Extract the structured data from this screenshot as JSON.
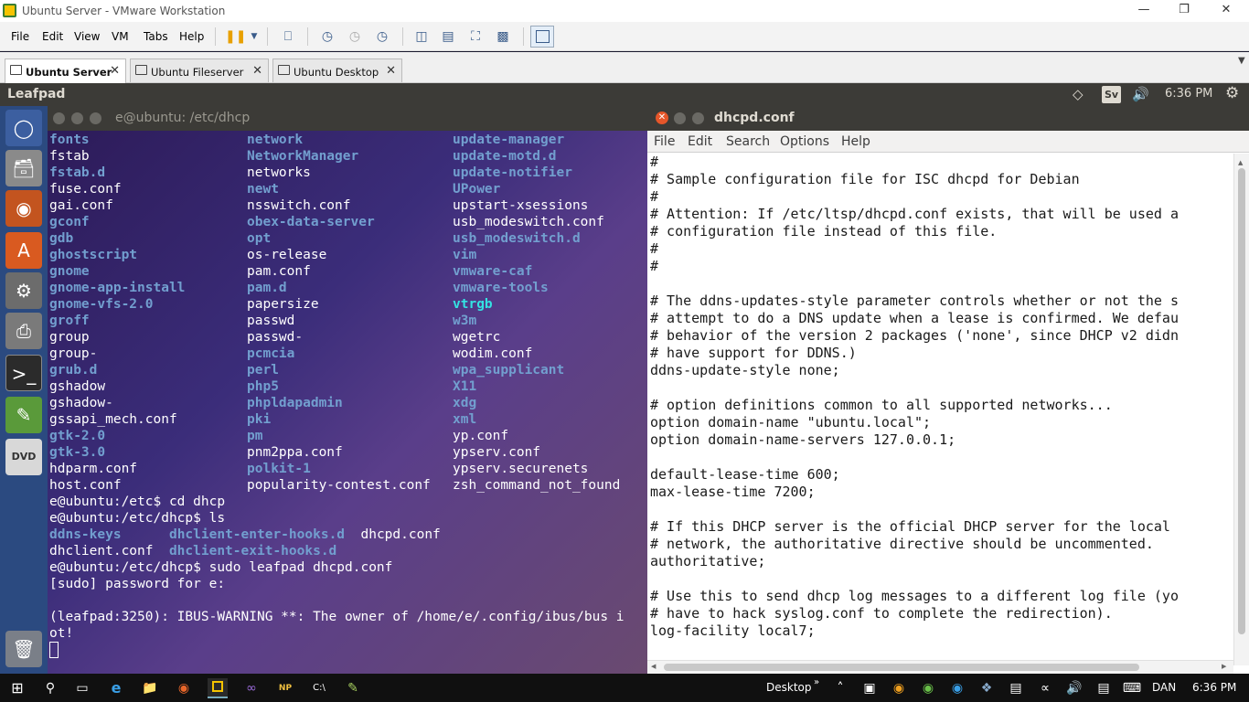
{
  "vm": {
    "title": "Ubuntu Server - VMware Workstation",
    "menus": [
      "File",
      "Edit",
      "View",
      "VM",
      "Tabs",
      "Help"
    ],
    "tabs": [
      {
        "label": "Ubuntu Server",
        "active": true
      },
      {
        "label": "Ubuntu Fileserver",
        "active": false
      },
      {
        "label": "Ubuntu Desktop",
        "active": false
      }
    ]
  },
  "ubuntu_panel": {
    "app_name": "Leafpad",
    "keyboard": "Sv",
    "clock": "6:36 PM"
  },
  "terminal": {
    "title": "e@ubuntu: /etc/dhcp",
    "listing": {
      "col1": [
        {
          "t": "fonts",
          "s": "b"
        },
        {
          "t": "fstab",
          "s": ""
        },
        {
          "t": "fstab.d",
          "s": "b"
        },
        {
          "t": "fuse.conf",
          "s": ""
        },
        {
          "t": "gai.conf",
          "s": ""
        },
        {
          "t": "gconf",
          "s": "b"
        },
        {
          "t": "gdb",
          "s": "b"
        },
        {
          "t": "ghostscript",
          "s": "b"
        },
        {
          "t": "gnome",
          "s": "b"
        },
        {
          "t": "gnome-app-install",
          "s": "b"
        },
        {
          "t": "gnome-vfs-2.0",
          "s": "b"
        },
        {
          "t": "groff",
          "s": "b"
        },
        {
          "t": "group",
          "s": ""
        },
        {
          "t": "group-",
          "s": ""
        },
        {
          "t": "grub.d",
          "s": "b"
        },
        {
          "t": "gshadow",
          "s": ""
        },
        {
          "t": "gshadow-",
          "s": ""
        },
        {
          "t": "gssapi_mech.conf",
          "s": ""
        },
        {
          "t": "gtk-2.0",
          "s": "b"
        },
        {
          "t": "gtk-3.0",
          "s": "b"
        },
        {
          "t": "hdparm.conf",
          "s": ""
        },
        {
          "t": "host.conf",
          "s": ""
        }
      ],
      "col2": [
        {
          "t": "network",
          "s": "b"
        },
        {
          "t": "NetworkManager",
          "s": "b"
        },
        {
          "t": "networks",
          "s": ""
        },
        {
          "t": "newt",
          "s": "b"
        },
        {
          "t": "nsswitch.conf",
          "s": ""
        },
        {
          "t": "obex-data-server",
          "s": "b"
        },
        {
          "t": "opt",
          "s": "b"
        },
        {
          "t": "os-release",
          "s": ""
        },
        {
          "t": "pam.conf",
          "s": ""
        },
        {
          "t": "pam.d",
          "s": "b"
        },
        {
          "t": "papersize",
          "s": ""
        },
        {
          "t": "passwd",
          "s": ""
        },
        {
          "t": "passwd-",
          "s": ""
        },
        {
          "t": "pcmcia",
          "s": "b"
        },
        {
          "t": "perl",
          "s": "b"
        },
        {
          "t": "php5",
          "s": "b"
        },
        {
          "t": "phpldapadmin",
          "s": "b"
        },
        {
          "t": "pki",
          "s": "b"
        },
        {
          "t": "pm",
          "s": "b"
        },
        {
          "t": "pnm2ppa.conf",
          "s": ""
        },
        {
          "t": "polkit-1",
          "s": "b"
        },
        {
          "t": "popularity-contest.conf",
          "s": ""
        }
      ],
      "col3": [
        {
          "t": "update-manager",
          "s": "b"
        },
        {
          "t": "update-motd.d",
          "s": "b"
        },
        {
          "t": "update-notifier",
          "s": "b"
        },
        {
          "t": "UPower",
          "s": "b"
        },
        {
          "t": "upstart-xsessions",
          "s": ""
        },
        {
          "t": "usb_modeswitch.conf",
          "s": ""
        },
        {
          "t": "usb_modeswitch.d",
          "s": "b"
        },
        {
          "t": "vim",
          "s": "b"
        },
        {
          "t": "vmware-caf",
          "s": "b"
        },
        {
          "t": "vmware-tools",
          "s": "b"
        },
        {
          "t": "vtrgb",
          "s": "bc"
        },
        {
          "t": "w3m",
          "s": "b"
        },
        {
          "t": "wgetrc",
          "s": ""
        },
        {
          "t": "wodim.conf",
          "s": ""
        },
        {
          "t": "wpa_supplicant",
          "s": "b"
        },
        {
          "t": "X11",
          "s": "b"
        },
        {
          "t": "xdg",
          "s": "b"
        },
        {
          "t": "xml",
          "s": "b"
        },
        {
          "t": "yp.conf",
          "s": ""
        },
        {
          "t": "ypserv.conf",
          "s": ""
        },
        {
          "t": "ypserv.securenets",
          "s": ""
        },
        {
          "t": "zsh_command_not_found",
          "s": ""
        }
      ]
    },
    "tail": [
      [
        {
          "t": "e@ubuntu:/etc$ cd dhcp",
          "s": ""
        }
      ],
      [
        {
          "t": "e@ubuntu:/etc/dhcp$ ls",
          "s": ""
        }
      ],
      [
        {
          "t": "ddns-keys",
          "s": "b"
        },
        {
          "t": "      ",
          "s": ""
        },
        {
          "t": "dhclient-enter-hooks.d",
          "s": "b"
        },
        {
          "t": "  dhcpd.conf",
          "s": ""
        }
      ],
      [
        {
          "t": "dhclient.conf  ",
          "s": ""
        },
        {
          "t": "dhclient-exit-hooks.d",
          "s": "b"
        }
      ],
      [
        {
          "t": "e@ubuntu:/etc/dhcp$ sudo leafpad dhcpd.conf",
          "s": ""
        }
      ],
      [
        {
          "t": "[sudo] password for e:",
          "s": ""
        }
      ],
      [
        {
          "t": "",
          "s": ""
        }
      ],
      [
        {
          "t": "(leafpad:3250): IBUS-WARNING **: The owner of /home/e/.config/ibus/bus i",
          "s": ""
        }
      ],
      [
        {
          "t": "ot!",
          "s": ""
        }
      ]
    ]
  },
  "leafpad": {
    "title": "dhcpd.conf",
    "menus": [
      "File",
      "Edit",
      "Search",
      "Options",
      "Help"
    ],
    "lines": [
      "#",
      "# Sample configuration file for ISC dhcpd for Debian",
      "#",
      "# Attention: If /etc/ltsp/dhcpd.conf exists, that will be used a",
      "# configuration file instead of this file.",
      "#",
      "#",
      "",
      "# The ddns-updates-style parameter controls whether or not the s",
      "# attempt to do a DNS update when a lease is confirmed. We defau",
      "# behavior of the version 2 packages ('none', since DHCP v2 didn",
      "# have support for DDNS.)",
      "ddns-update-style none;",
      "",
      "# option definitions common to all supported networks...",
      "option domain-name \"ubuntu.local\";",
      "option domain-name-servers 127.0.0.1;",
      "",
      "default-lease-time 600;",
      "max-lease-time 7200;",
      "",
      "# If this DHCP server is the official DHCP server for the local",
      "# network, the authoritative directive should be uncommented.",
      "authoritative;",
      "",
      "# Use this to send dhcp log messages to a different log file (yo",
      "# have to hack syslog.conf to complete the redirection).",
      "log-facility local7;"
    ]
  },
  "taskbar": {
    "desktop_label": "Desktop",
    "language": "DAN",
    "clock": "6:36 PM"
  }
}
